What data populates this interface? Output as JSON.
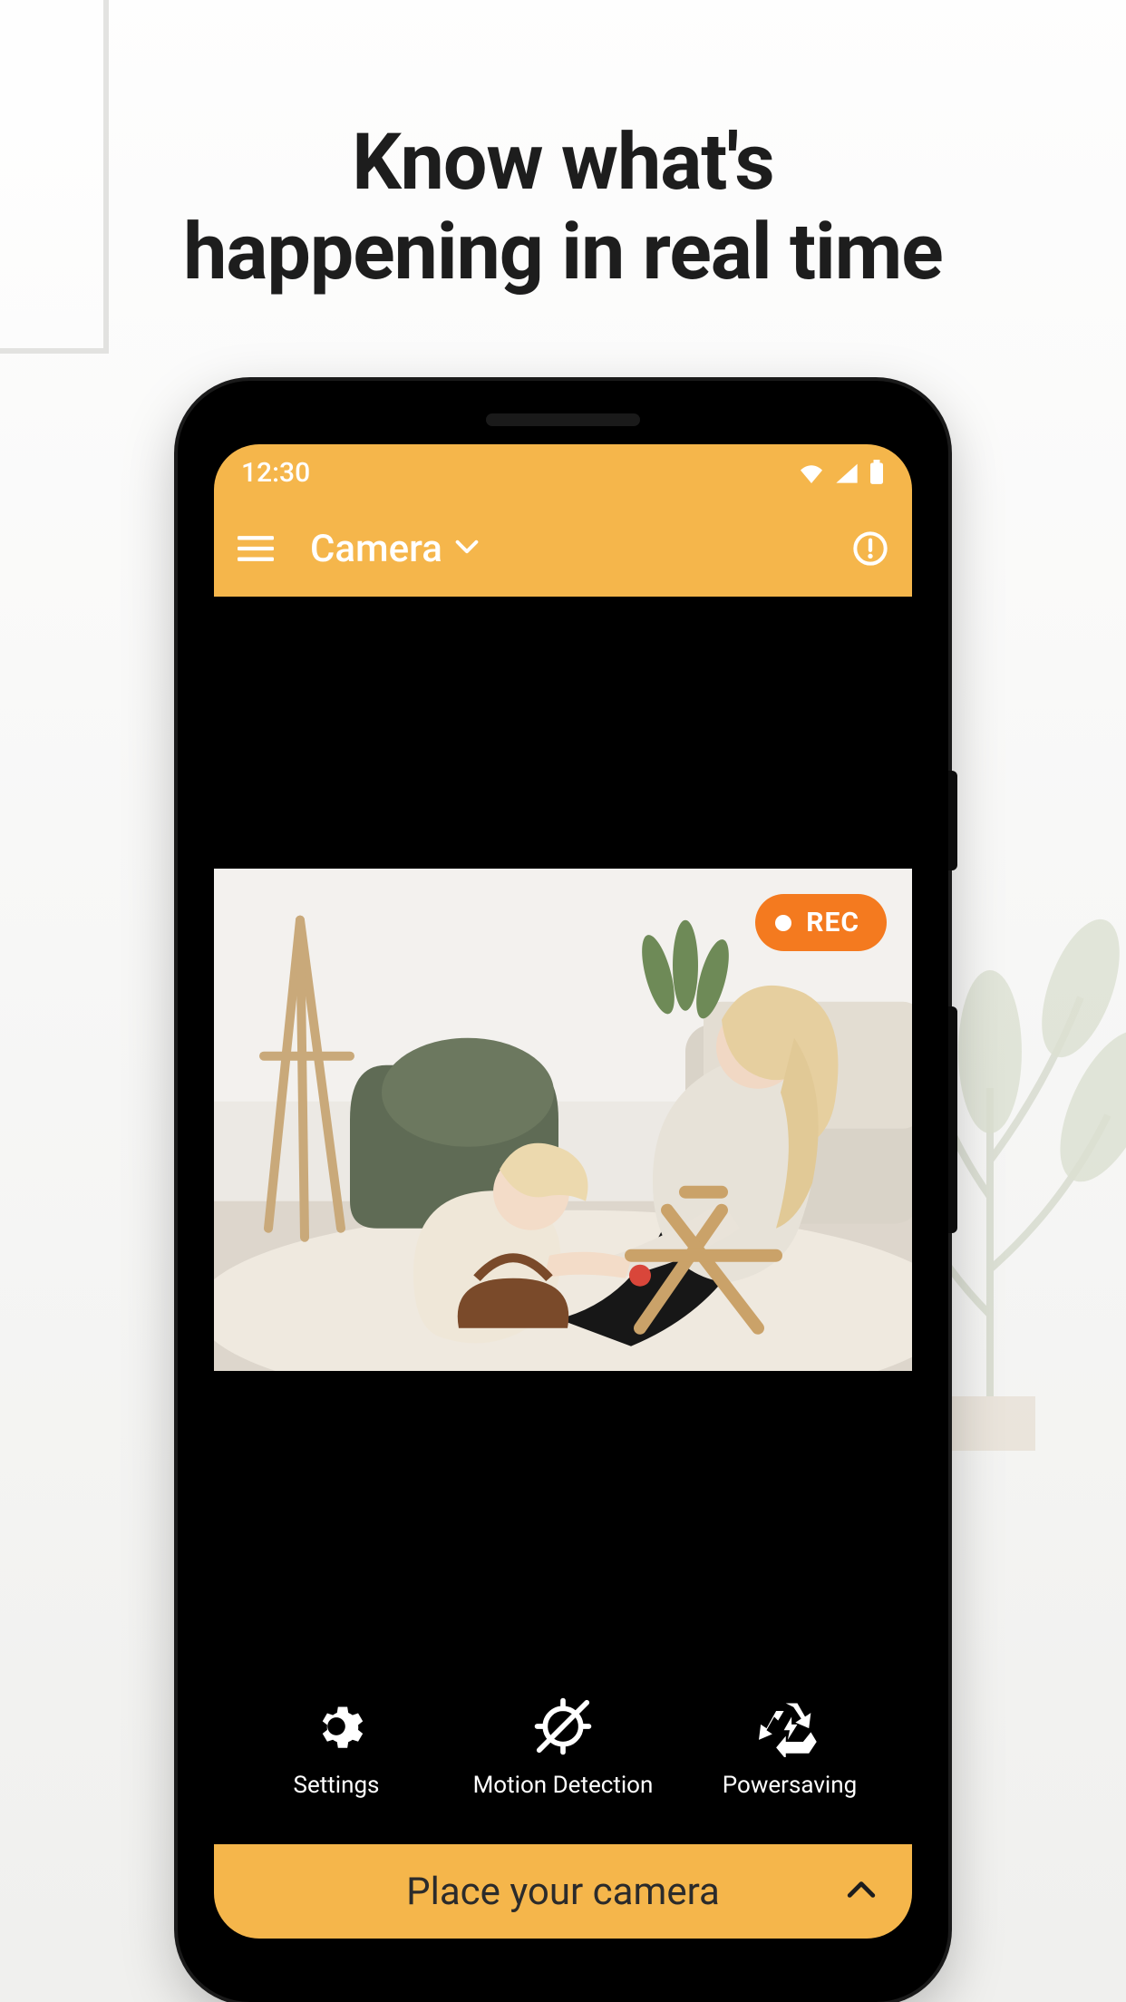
{
  "promo": {
    "headline_line1": "Know what's",
    "headline_line2": "happening in real time"
  },
  "statusbar": {
    "time": "12:30",
    "wifi_icon": "wifi-icon",
    "signal_icon": "cell-signal-icon",
    "battery_icon": "battery-icon"
  },
  "appbar": {
    "menu_icon": "hamburger-icon",
    "title": "Camera",
    "title_chevron_icon": "chevron-down-icon",
    "alert_icon": "alert-circle-icon"
  },
  "video": {
    "rec_label": "REC",
    "scene_description": "Mother and toddler playing on rug in living room"
  },
  "actions": [
    {
      "icon": "gear-icon",
      "label": "Settings"
    },
    {
      "icon": "motion-off-icon",
      "label": "Motion Detection"
    },
    {
      "icon": "recycle-power-icon",
      "label": "Powersaving"
    }
  ],
  "sheet": {
    "label": "Place your camera",
    "chevron_icon": "chevron-up-icon"
  },
  "colors": {
    "accent": "#f5b64b",
    "rec": "#f47a1f"
  }
}
